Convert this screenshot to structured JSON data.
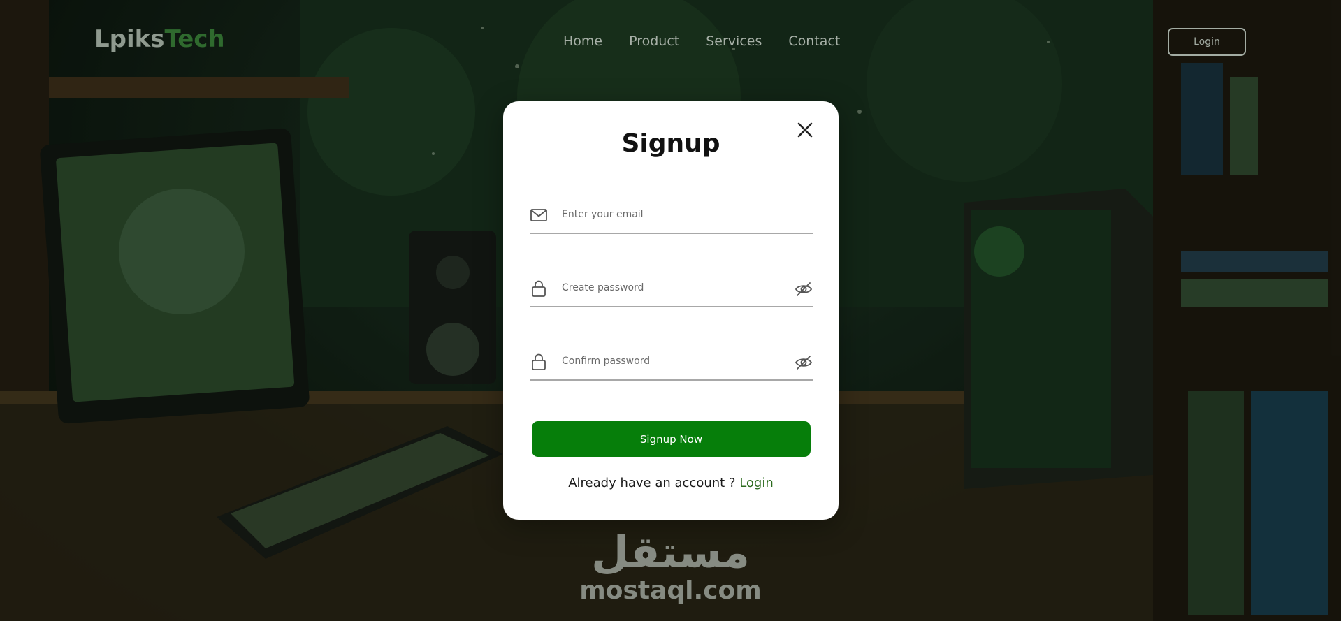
{
  "header": {
    "logo_primary": "Lpiks",
    "logo_accent": "Tech",
    "nav": [
      "Home",
      "Product",
      "Services",
      "Contact"
    ],
    "login_label": "Login"
  },
  "modal": {
    "title": "Signup",
    "email_placeholder": "Enter your email",
    "password_placeholder": "Create password",
    "confirm_placeholder": "Confirm password",
    "submit_label": "Signup Now",
    "switch_text": "Already have an account ? ",
    "switch_link": "Login"
  },
  "watermark": {
    "arabic": "مستقل",
    "latin": "mostaql.com"
  },
  "colors": {
    "accent": "#067e0a",
    "link": "#2c6b1e",
    "modal_bg": "#ffffff"
  },
  "icons": {
    "email": "envelope-icon",
    "password": "lock-icon",
    "visibility": "eye-slash-icon",
    "close": "close-icon"
  }
}
